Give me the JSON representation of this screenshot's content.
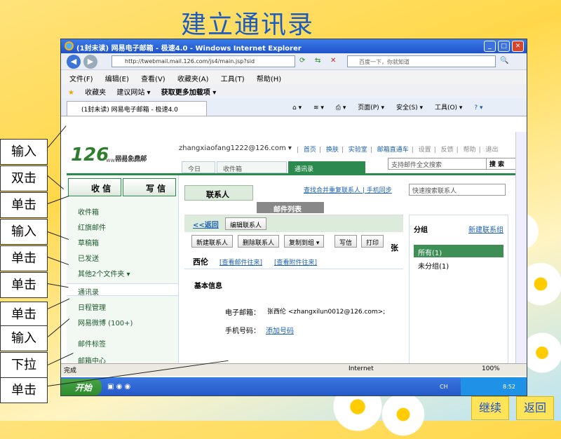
{
  "slide": {
    "title": "建立通讯录"
  },
  "window": {
    "title": "(1封未读) 网易电子邮箱 - 极速4.0 - Windows Internet Explorer",
    "min": "_",
    "max": "□",
    "close": "✕"
  },
  "address_bar": {
    "url": "http://twebmail.mail.126.com/js4/main.jsp?sid",
    "search_placeholder": "百度一下，你就知道"
  },
  "menu": [
    "文件(F)",
    "编辑(E)",
    "查看(V)",
    "收藏夹(A)",
    "工具(T)",
    "帮助(H)"
  ],
  "favorites_bar": [
    "收藏夹",
    "建议网站 ▾",
    "获取更多加载项 ▾"
  ],
  "browser_tab": {
    "label": "(1封未读) 网易电子邮箱 - 极速4.0"
  },
  "browser_tools": [
    "页面(P) ▾",
    "安全(S) ▾",
    "工具(O) ▾"
  ],
  "mail": {
    "logo": "126",
    "logo_sub": "网易免费邮",
    "logo_url": "www.126.com",
    "user": "zhangxiaofang1222@126.com ▾",
    "top_links": [
      "首页",
      "换肤",
      "实验室",
      "邮箱直通车",
      "设置",
      "反馈",
      "帮助",
      "退出"
    ],
    "tabs": [
      "今日",
      "收件箱",
      "通讯录"
    ],
    "search_placeholder": "支持邮件全文搜索",
    "search_button": "搜 索",
    "receive": "收 信",
    "compose": "写 信",
    "folders": [
      "收件箱",
      "红旗邮件",
      "草稿箱",
      "已发送",
      "其他2个文件夹 ▾",
      "通讯录",
      "日程管理",
      "网易微博 (100+)",
      "邮件标签",
      "邮箱中心"
    ]
  },
  "contacts": {
    "tab": "联系人",
    "links": [
      "查找合并重复联系人",
      "手机同步"
    ],
    "search_placeholder": "快速搜索联系人",
    "list_header": "邮件列表",
    "back": "<<返回",
    "edit": "编辑联系人",
    "toolbar": [
      "新建联系人",
      "删除联系人",
      "复制到组 ▾",
      "写信",
      "打印"
    ],
    "name": "西伦",
    "view_mail": "[查看邮件往来]",
    "view_attach": "[查看附件往来]",
    "overflow_char": "张",
    "basic_info": "基本信息",
    "email_label": "电子邮箱：",
    "email_value": "张西伦 <zhangxilun0012@126.com>;",
    "phone_label": "手机号码：",
    "phone_value": "添加号码",
    "group_title": "分组",
    "new_group": "新建联系组",
    "groups": [
      "所有(1)",
      "未分组(1)"
    ]
  },
  "status": {
    "left": "完成",
    "zone": "Internet",
    "zoom": "100%"
  },
  "taskbar": {
    "start": "开始",
    "lang": "CH",
    "time": "8:52"
  },
  "steps": [
    "输入",
    "双击",
    "单击",
    "输入",
    "单击",
    "单击",
    "单击",
    "输入",
    "下拉",
    "单击"
  ],
  "nav": {
    "continue": "继续",
    "back": "返回"
  }
}
